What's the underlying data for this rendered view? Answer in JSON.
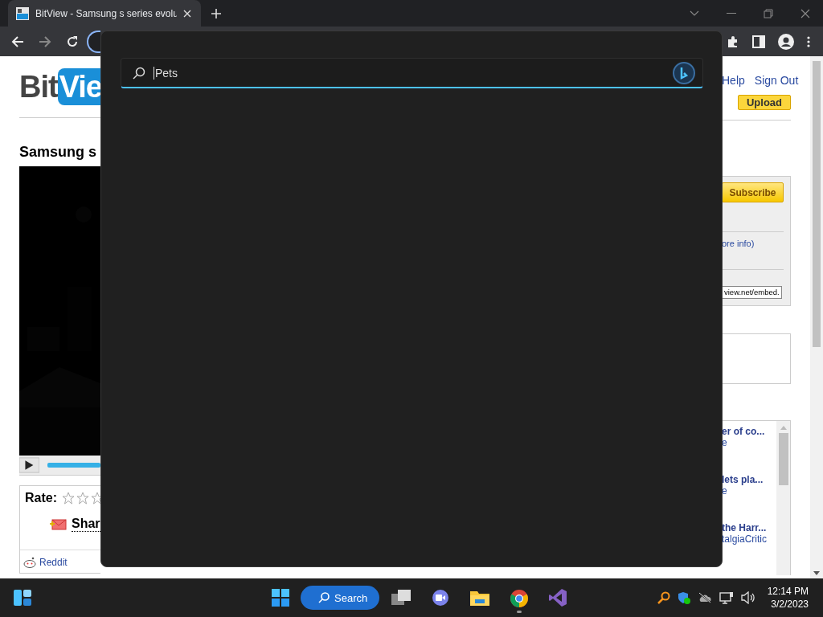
{
  "browser": {
    "tab": {
      "title": "BitView - Samsung s series evolu",
      "selected": true
    }
  },
  "page": {
    "logo": [
      "Bit",
      "Vie"
    ],
    "title": "Samsung s",
    "rate_label": "Rate:",
    "stars": 0,
    "share": "Shar",
    "reddit": "Reddit",
    "links": [
      "Help",
      "Sign Out"
    ],
    "upload": "Upload",
    "subscribe": "Subscribe",
    "more_info": "ore info)",
    "embed_value": "view.net/embed.",
    "videos": [
      {
        "title": "er of co...",
        "meta": "e"
      },
      {
        "title": "lets pla...",
        "meta": "e"
      },
      {
        "title": "the Harr...",
        "meta": "talgiaCritic"
      }
    ]
  },
  "search_flyout": {
    "value": "Pets"
  },
  "taskbar": {
    "search": "Search",
    "time": "12:14 PM",
    "date": "3/2/2023"
  }
}
